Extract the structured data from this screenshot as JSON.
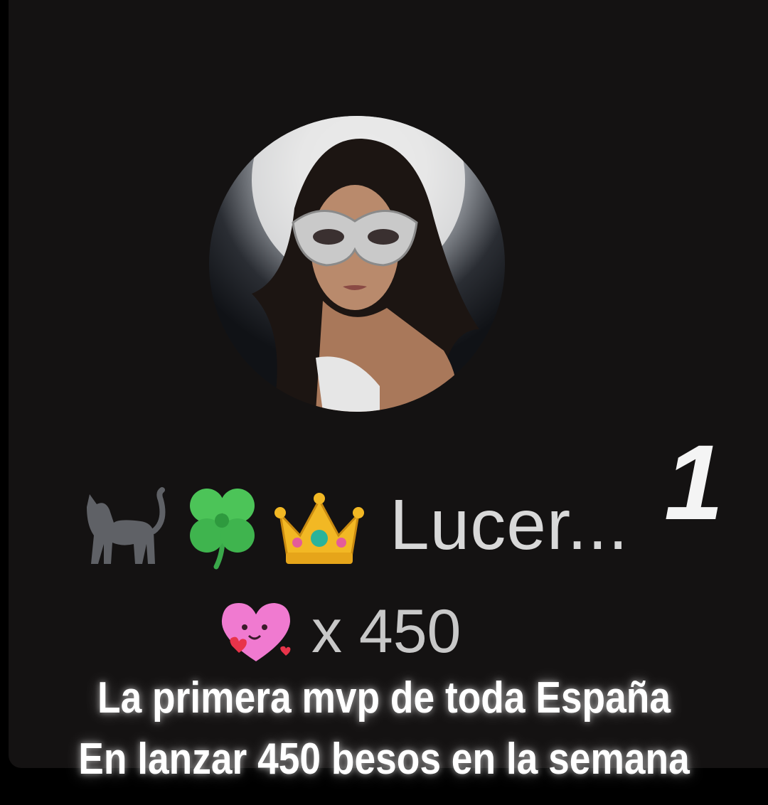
{
  "profile": {
    "rank": "1",
    "emojis": [
      "cat-icon",
      "clover-icon",
      "crown-icon"
    ],
    "name": "Lucer...",
    "gift_icon": "heart-kiss-icon",
    "gift_count": "x 450"
  },
  "caption": {
    "line1": "La primera mvp de toda España",
    "line2": "En lanzar 450 besos en la semana"
  },
  "colors": {
    "background": "#141212",
    "name_text": "#d8d8d8",
    "caption_text": "#ffffff"
  }
}
